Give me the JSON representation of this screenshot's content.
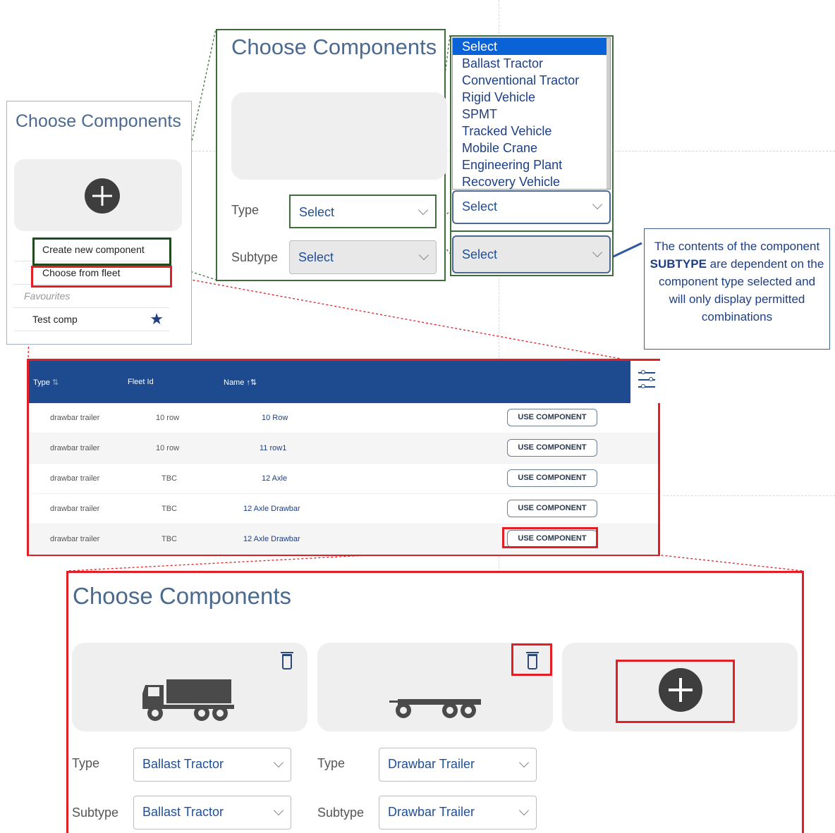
{
  "panel_small": {
    "title": "Choose Components",
    "menu": {
      "create_new": "Create new component",
      "choose_fleet": "Choose from fleet",
      "favourites": "Favourites",
      "test_comp": "Test comp"
    }
  },
  "panel_form": {
    "title": "Choose Components",
    "type_label": "Type",
    "type_value": "Select",
    "subtype_label": "Subtype",
    "subtype_value": "Select"
  },
  "type_dropdown": {
    "options": [
      "Select",
      "Ballast Tractor",
      "Conventional Tractor",
      "Rigid Vehicle",
      "SPMT",
      "Tracked Vehicle",
      "Mobile Crane",
      "Engineering Plant",
      "Recovery Vehicle"
    ],
    "selected": "Select",
    "type_select_value": "Select",
    "subtype_select_value": "Select"
  },
  "callout": {
    "text_before": "The contents of the component ",
    "text_bold": "SUBTYPE",
    "text_after": " are dependent on the component type selected and will only display permitted combinations"
  },
  "fleet_table": {
    "columns": {
      "type": "Type",
      "fleet_id": "Fleet Id",
      "name": "Name"
    },
    "button_label": "USE COMPONENT",
    "rows": [
      {
        "type": "drawbar trailer",
        "fleet_id": "10 row",
        "name": "10 Row"
      },
      {
        "type": "drawbar trailer",
        "fleet_id": "10 row",
        "name": "11 row1"
      },
      {
        "type": "drawbar trailer",
        "fleet_id": "TBC",
        "name": "12 Axle"
      },
      {
        "type": "drawbar trailer",
        "fleet_id": "TBC",
        "name": "12 Axle Drawbar"
      },
      {
        "type": "drawbar trailer",
        "fleet_id": "TBC",
        "name": "12 Axle Drawbar"
      }
    ]
  },
  "panel_result": {
    "title": "Choose Components",
    "component1": {
      "type_label": "Type",
      "type_value": "Ballast Tractor",
      "subtype_label": "Subtype",
      "subtype_value": "Ballast Tractor"
    },
    "component2": {
      "type_label": "Type",
      "type_value": "Drawbar Trailer",
      "subtype_label": "Subtype",
      "subtype_value": "Drawbar Trailer"
    }
  },
  "colors": {
    "header_blue": "#1e4b8f",
    "highlight_red": "#e31e24",
    "highlight_green": "#3f6c3a",
    "link_blue": "#1c3f86"
  }
}
